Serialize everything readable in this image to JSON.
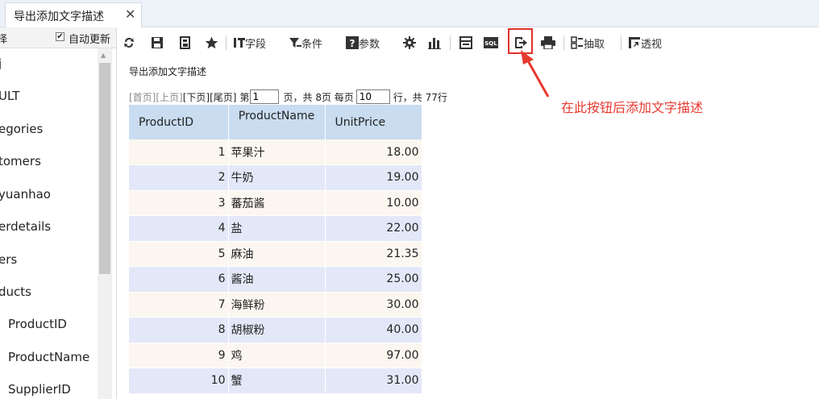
{
  "tab": {
    "label": "导出添加文字描述",
    "close": "✕"
  },
  "left_panel": {
    "header_text": "择",
    "auto_update_label": "自动更新",
    "auto_update_checked": true,
    "tree": [
      "j",
      "ULT",
      "egories",
      "tomers",
      "yuanhao",
      "erdetails",
      "ers",
      "ducts",
      "ProductID",
      "ProductName",
      "SupplierID"
    ]
  },
  "toolbar": {
    "field_label": "字段",
    "condition_label": "条件",
    "param_label": "参数",
    "extract_label": "抽取",
    "pivot_label": "透视",
    "sql_label": "SQL"
  },
  "report_title": "导出添加文字描述",
  "pager": {
    "first": "[首页]",
    "prev": "[上页]",
    "next": "[下页]",
    "last": "[尾页]",
    "page_prefix": "第",
    "page_value": "1",
    "page_suffix": "页，共 8页 每页",
    "per_page_value": "10",
    "rows_suffix": "行，共 77行"
  },
  "annotation": "在此按钮后添加文字描述",
  "table": {
    "columns": [
      "ProductID",
      "ProductName",
      "UnitPrice"
    ],
    "rows": [
      [
        "1",
        "苹果汁",
        "18.00"
      ],
      [
        "2",
        "牛奶",
        "19.00"
      ],
      [
        "3",
        "蕃茄酱",
        "10.00"
      ],
      [
        "4",
        "盐",
        "22.00"
      ],
      [
        "5",
        "麻油",
        "21.35"
      ],
      [
        "6",
        "酱油",
        "25.00"
      ],
      [
        "7",
        "海鲜粉",
        "30.00"
      ],
      [
        "8",
        "胡椒粉",
        "40.00"
      ],
      [
        "9",
        "鸡",
        "97.00"
      ],
      [
        "10",
        "蟹",
        "31.00"
      ]
    ]
  },
  "colors": {
    "annotation": "#e8392f",
    "header_bg": "#c9dcf0",
    "row_odd": "#fbf7f0",
    "row_even": "#e3e8f8"
  }
}
